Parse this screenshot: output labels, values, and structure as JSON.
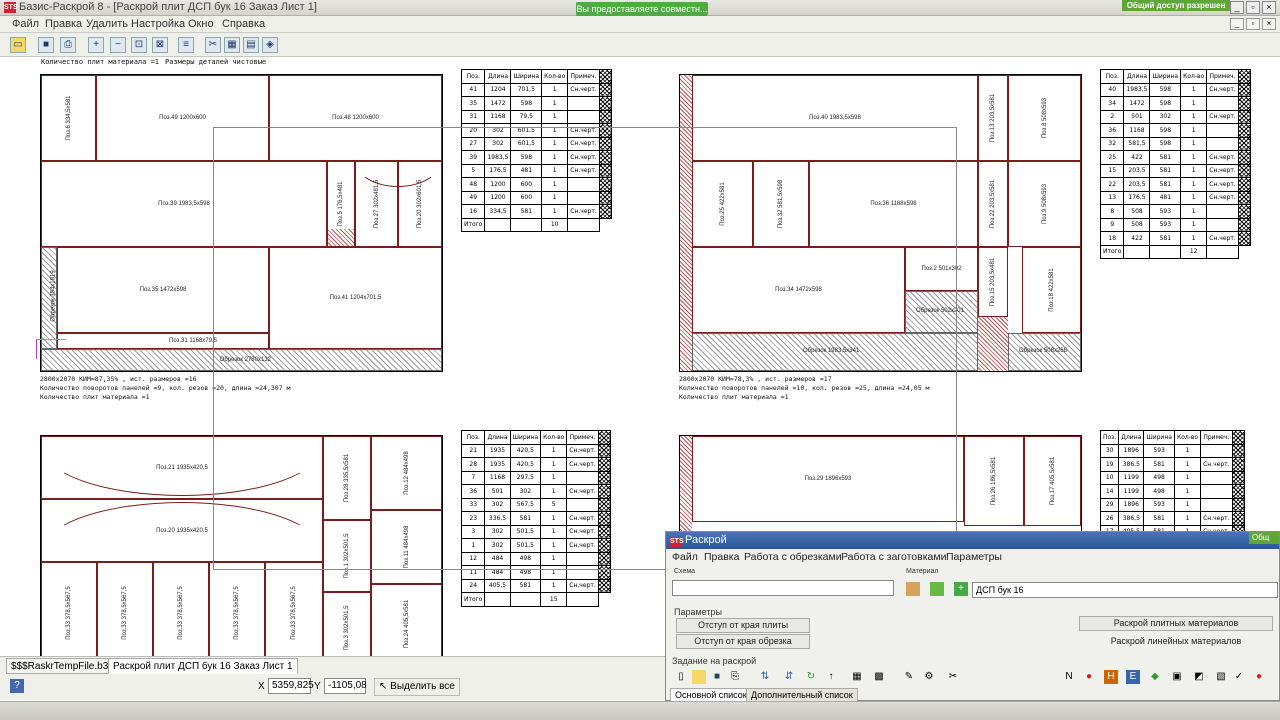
{
  "window": {
    "title": "Базис-Раскрой 8 - [Раскрой плит ДСП бук 16 Заказ  Лист 1]",
    "logo": "STS",
    "share_badge": "Общий доступ разрешен",
    "notification": "Вы предоставляете совместн..."
  },
  "menu": [
    "Файл",
    "Правка",
    "Удалить",
    "Настройка",
    "Окно",
    "Справка"
  ],
  "toolbar_icons": [
    "open-folder-icon",
    "save-icon",
    "print-icon",
    "zoom-in-icon",
    "zoom-out-icon",
    "zoom-fit-icon",
    "zoom-window-icon",
    "list-icon",
    "cut-icon",
    "layout-icon",
    "layout2-icon",
    "nest-icon"
  ],
  "sheet_header": {
    "line1": "Количество плит материала =1",
    "line2": "Размеры деталей чистовые"
  },
  "table_headers": [
    "Поз.",
    "Длина",
    "Ширина",
    "Кол-во",
    "Примеч."
  ],
  "sheet1": {
    "parts": [
      {
        "label": "Поз.6  334,5x581"
      },
      {
        "label": "Поз.49  1200x600"
      },
      {
        "label": "Поз.48  1200x600"
      },
      {
        "label": "Поз.39  1983,5x598"
      },
      {
        "label": "Поз.5  176,5x481"
      },
      {
        "label": "Поз.27  302x481,5"
      },
      {
        "label": "Поз.20  302x601,5"
      },
      {
        "label": "Обрезок  354x1819"
      },
      {
        "label": "Поз.35  1472x598"
      },
      {
        "label": "Поз.41  1204x701,5"
      },
      {
        "label": "Поз.31  1168x79,5"
      },
      {
        "label": "Обрезок  2780x132"
      }
    ],
    "table": [
      [
        "41",
        "1204",
        "701,5",
        "1",
        "Сн.черт."
      ],
      [
        "35",
        "1472",
        "598",
        "1",
        ""
      ],
      [
        "31",
        "1168",
        "79,5",
        "1",
        ""
      ],
      [
        "20",
        "302",
        "601,5",
        "1",
        "Сн.черт."
      ],
      [
        "27",
        "302",
        "601,5",
        "1",
        "Сн.черт."
      ],
      [
        "39",
        "1983,5",
        "598",
        "1",
        "Сн.черт."
      ],
      [
        "5",
        "176,5",
        "481",
        "1",
        "Сн.черт."
      ],
      [
        "48",
        "1200",
        "600",
        "1",
        ""
      ],
      [
        "49",
        "1200",
        "600",
        "1",
        ""
      ],
      [
        "16",
        "334,5",
        "581",
        "1",
        "Сн.черт."
      ]
    ],
    "total": [
      "Итого",
      "",
      "",
      "10",
      ""
    ],
    "stats": [
      "2800x2070  КИМ=87,35% ,  ист. размеров  =16",
      "Количество поворотов панелей =9, кол. резов =20, длина =24,307 м",
      "Количество плит материала =1"
    ]
  },
  "sheet2": {
    "parts": [
      {
        "label": "Поз.40  1983,5x598"
      },
      {
        "label": "Поз.13  203,5x581"
      },
      {
        "label": "Поз.8  508x593"
      },
      {
        "label": "Поз.25  422x581"
      },
      {
        "label": "Поз.32  581,5x598"
      },
      {
        "label": "Поз.36  1168x598"
      },
      {
        "label": "Поз.22  203,5x581"
      },
      {
        "label": "Поз.9  508x593"
      },
      {
        "label": "Поз.2  501x302"
      },
      {
        "label": "Поз.34  1472x598"
      },
      {
        "label": "Поз.15  203,5x481"
      },
      {
        "label": "Поз.18  422x581"
      },
      {
        "label": "Обрезок  502x201"
      },
      {
        "label": "Обрезок  1983,5x341"
      },
      {
        "label": "Обрезок  508x268"
      }
    ],
    "table": [
      [
        "40",
        "1983,5",
        "598",
        "1",
        "Сн.черт."
      ],
      [
        "34",
        "1472",
        "598",
        "1",
        ""
      ],
      [
        "2",
        "501",
        "302",
        "1",
        "Сн.черт."
      ],
      [
        "36",
        "1168",
        "598",
        "1",
        ""
      ],
      [
        "32",
        "581,5",
        "598",
        "1",
        ""
      ],
      [
        "25",
        "422",
        "581",
        "1",
        "Сн.черт."
      ],
      [
        "15",
        "203,5",
        "581",
        "1",
        "Сн.черт."
      ],
      [
        "22",
        "203,5",
        "581",
        "1",
        "Сн.черт."
      ],
      [
        "13",
        "176,5",
        "481",
        "1",
        "Сн.черт."
      ],
      [
        "8",
        "508",
        "593",
        "1",
        ""
      ],
      [
        "9",
        "508",
        "593",
        "1",
        ""
      ],
      [
        "18",
        "422",
        "581",
        "1",
        "Сн.черт."
      ]
    ],
    "total": [
      "Итого",
      "",
      "",
      "12",
      ""
    ],
    "stats": [
      "2800x2070  КИМ=78,3% ,  ист. размеров  =17",
      "Количество поворотов панелей =10, кол. резов =25, длина =24,05 м",
      "Количество плит материала =1"
    ]
  },
  "sheet3": {
    "parts": [
      {
        "label": "Поз.21  1935x420,5"
      },
      {
        "label": "Поз.28  335,5x581"
      },
      {
        "label": "Поз.12  484x498"
      },
      {
        "label": "Поз.20  1935x420,5"
      },
      {
        "label": "Поз.11  484x498"
      },
      {
        "label": "Поз.33  378,5x567,5"
      },
      {
        "label": "Поз.33  378,5x567,5"
      },
      {
        "label": "Поз.33  378,5x567,5"
      },
      {
        "label": "Поз.33  378,5x567,5"
      },
      {
        "label": "Поз.33  378,5x567,5"
      },
      {
        "label": "Поз.1  302x501,5"
      },
      {
        "label": "Поз.3  302x501,5"
      },
      {
        "label": "Поз.24  405,5x581"
      }
    ],
    "table": [
      [
        "21",
        "1935",
        "420,5",
        "1",
        "Сн.черт."
      ],
      [
        "28",
        "1935",
        "420,5",
        "1",
        "Сн.черт."
      ],
      [
        "7",
        "1168",
        "297,5",
        "1",
        ""
      ],
      [
        "36",
        "501",
        "302",
        "1",
        "Сн.черт."
      ],
      [
        "33",
        "302",
        "567,5",
        "5",
        ""
      ],
      [
        "23",
        "336,5",
        "581",
        "1",
        "Сн.черт."
      ],
      [
        "3",
        "302",
        "501,5",
        "1",
        "Сн.черт."
      ],
      [
        "1",
        "302",
        "501,5",
        "1",
        "Сн.черт."
      ],
      [
        "12",
        "484",
        "498",
        "1",
        ""
      ],
      [
        "11",
        "484",
        "498",
        "1",
        ""
      ],
      [
        "24",
        "405,5",
        "581",
        "1",
        "Сн.черт."
      ]
    ],
    "total": [
      "Итого",
      "",
      "",
      "15",
      ""
    ]
  },
  "sheet4": {
    "parts": [
      {
        "label": "Поз.29  1896x593"
      },
      {
        "label": "Поз.26  186,5x581"
      },
      {
        "label": "Поз.17  405,5x581"
      }
    ],
    "table": [
      [
        "30",
        "1896",
        "593",
        "1",
        ""
      ],
      [
        "19",
        "386,5",
        "581",
        "1",
        "Сн.черт."
      ],
      [
        "10",
        "1199",
        "498",
        "1",
        ""
      ],
      [
        "14",
        "1199",
        "498",
        "1",
        ""
      ],
      [
        "29",
        "1896",
        "593",
        "1",
        ""
      ],
      [
        "26",
        "386,5",
        "581",
        "1",
        "Сн.черт."
      ],
      [
        "17",
        "405,5",
        "581",
        "1",
        "Сн.черт."
      ]
    ]
  },
  "raskroy": {
    "title": "Раскрой",
    "logo": "STS",
    "menu": [
      "Файл",
      "Правка",
      "Работа с обрезками",
      "Работа с заготовками",
      "Параметры"
    ],
    "label_name": "Схема",
    "label_material": "Материал",
    "material_value": "ДСП бук 16",
    "params_label": "Параметры",
    "btn_edge": "Отступ от края плиты",
    "btn_offcut": "Отступ от края обрезка",
    "btn_plate": "Раскрой плитных материалов",
    "btn_linear": "Раскрой линейных материалов",
    "task_label": "Задание на раскрой",
    "tab_main": "Основной список",
    "tab_extra": "Дополнительный список",
    "share": "Общ"
  },
  "tabs": {
    "file": "$$$RaskrTempFile.b3d",
    "doc": "Раскрой плит ДСП бук 16 Заказ  Лист 1"
  },
  "status": {
    "x_label": "X",
    "x_value": "5359,825",
    "y_label": "Y",
    "y_value": "-1105,08",
    "select_all": "Выделить все"
  }
}
